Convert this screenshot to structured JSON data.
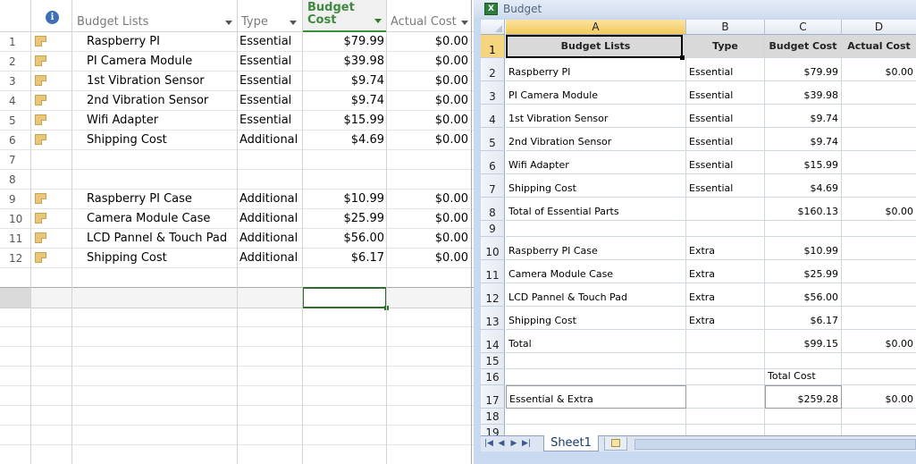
{
  "left_pane": {
    "columns": {
      "info_icon": "i",
      "name": "Budget Lists",
      "type": "Type",
      "budget": "Budget Cost",
      "actual": "Actual Cost"
    },
    "rows": [
      {
        "num": "1",
        "note": true,
        "name": "Raspberry PI",
        "type": "Essential",
        "budget": "$79.99",
        "actual": "$0.00"
      },
      {
        "num": "2",
        "note": true,
        "name": "PI Camera Module",
        "type": "Essential",
        "budget": "$39.98",
        "actual": "$0.00"
      },
      {
        "num": "3",
        "note": true,
        "name": "1st Vibration Sensor",
        "type": "Essential",
        "budget": "$9.74",
        "actual": "$0.00"
      },
      {
        "num": "4",
        "note": true,
        "name": "2nd Vibration Sensor",
        "type": "Essential",
        "budget": "$9.74",
        "actual": "$0.00"
      },
      {
        "num": "5",
        "note": true,
        "name": "Wifi Adapter",
        "type": "Essential",
        "budget": "$15.99",
        "actual": "$0.00"
      },
      {
        "num": "6",
        "note": true,
        "name": "Shipping Cost",
        "type": "Additional",
        "budget": "$4.69",
        "actual": "$0.00"
      },
      {
        "num": "7",
        "note": false,
        "name": "",
        "type": "",
        "budget": "",
        "actual": ""
      },
      {
        "num": "8",
        "note": false,
        "name": "",
        "type": "",
        "budget": "",
        "actual": ""
      },
      {
        "num": "9",
        "note": true,
        "name": "Raspberry PI Case",
        "type": "Additional",
        "budget": "$10.99",
        "actual": "$0.00"
      },
      {
        "num": "10",
        "note": true,
        "name": "Camera Module Case",
        "type": "Additional",
        "budget": "$25.99",
        "actual": "$0.00"
      },
      {
        "num": "11",
        "note": true,
        "name": "LCD Pannel & Touch Pad",
        "type": "Additional",
        "budget": "$56.00",
        "actual": "$0.00"
      },
      {
        "num": "12",
        "note": true,
        "name": "Shipping Cost",
        "type": "Additional",
        "budget": "$6.17",
        "actual": "$0.00"
      }
    ]
  },
  "excel": {
    "window_title": "Budget",
    "logo": "X",
    "col_headers": [
      "A",
      "B",
      "C",
      "D"
    ],
    "header_row": {
      "a": "Budget Lists",
      "b": "Type",
      "c": "Budget Cost",
      "d": "Actual Cost"
    },
    "rows": [
      {
        "num": "2",
        "a": "Raspberry PI",
        "b": "Essential",
        "c": "$79.99",
        "d": "$0.00"
      },
      {
        "num": "3",
        "a": "PI Camera Module",
        "b": "Essential",
        "c": "$39.98",
        "d": ""
      },
      {
        "num": "4",
        "a": "1st Vibration Sensor",
        "b": "Essential",
        "c": "$9.74",
        "d": ""
      },
      {
        "num": "5",
        "a": "2nd Vibration Sensor",
        "b": "Essential",
        "c": "$9.74",
        "d": ""
      },
      {
        "num": "6",
        "a": "Wifi Adapter",
        "b": "Essential",
        "c": "$15.99",
        "d": ""
      },
      {
        "num": "7",
        "a": "Shipping Cost",
        "b": "Essential",
        "c": "$4.69",
        "d": ""
      },
      {
        "num": "8",
        "a": "Total of Essential Parts",
        "b": "",
        "c": "$160.13",
        "d": "$0.00"
      },
      {
        "num": "9",
        "a": "",
        "b": "",
        "c": "",
        "d": ""
      },
      {
        "num": "10",
        "a": "Raspberry PI Case",
        "b": "Extra",
        "c": "$10.99",
        "d": ""
      },
      {
        "num": "11",
        "a": "Camera Module Case",
        "b": "Extra",
        "c": "$25.99",
        "d": ""
      },
      {
        "num": "12",
        "a": "LCD Pannel & Touch Pad",
        "b": "Extra",
        "c": "$56.00",
        "d": ""
      },
      {
        "num": "13",
        "a": "Shipping Cost",
        "b": "Extra",
        "c": "$6.17",
        "d": ""
      },
      {
        "num": "14",
        "a": "Total",
        "b": "",
        "c": "$99.15",
        "d": "$0.00"
      },
      {
        "num": "15",
        "a": "",
        "b": "",
        "c": "",
        "d": ""
      },
      {
        "num": "16",
        "a": "",
        "b": "",
        "c": "Total Cost",
        "d": ""
      },
      {
        "num": "17",
        "a": "Essential & Extra",
        "b": "",
        "c": "$259.28",
        "d": "$0.00"
      },
      {
        "num": "18",
        "a": "",
        "b": "",
        "c": "",
        "d": ""
      },
      {
        "num": "19",
        "a": "",
        "b": "",
        "c": "",
        "d": ""
      }
    ],
    "header_row_num": "1",
    "sheet_tab": "Sheet1",
    "nav_buttons": [
      "|◀",
      "◀",
      "▶",
      "▶|"
    ]
  }
}
